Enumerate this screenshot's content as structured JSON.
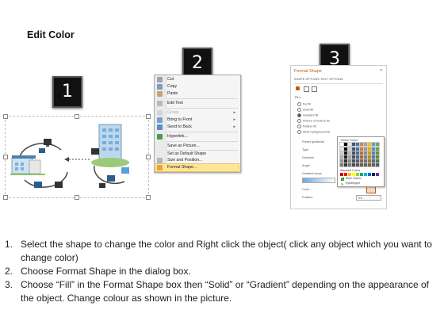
{
  "title": "Edit Color",
  "badges": [
    "1",
    "2",
    "3"
  ],
  "context_menu": {
    "items": [
      {
        "label": "Cut",
        "disabled": false,
        "submenu": false
      },
      {
        "label": "Copy",
        "disabled": false,
        "submenu": false
      },
      {
        "label": "Paste",
        "disabled": false,
        "submenu": false
      },
      {
        "label": "Edit Text",
        "disabled": false,
        "submenu": false
      },
      {
        "label": "Group",
        "disabled": true,
        "submenu": true
      },
      {
        "label": "Bring to Front",
        "disabled": false,
        "submenu": true
      },
      {
        "label": "Send to Back",
        "disabled": false,
        "submenu": true
      },
      {
        "label": "Hyperlink...",
        "disabled": false,
        "submenu": false
      },
      {
        "label": "Save as Picture...",
        "disabled": false,
        "submenu": false
      },
      {
        "label": "Set as Default Shape",
        "disabled": false,
        "submenu": false
      },
      {
        "label": "Size and Position...",
        "disabled": false,
        "submenu": false
      },
      {
        "label": "Format Shape...",
        "disabled": false,
        "submenu": false,
        "highlighted": true
      }
    ]
  },
  "format_pane": {
    "title": "Format Shape",
    "tabs": "SHAPE OPTIONS   TEXT OPTIONS",
    "fill_header": "FILL",
    "fill_options": [
      "No fill",
      "Solid fill",
      "Gradient fill",
      "Picture or texture fill",
      "Pattern fill",
      "Slide background fill"
    ],
    "fields": [
      "Preset gradients",
      "Type",
      "Direction",
      "Angle",
      "Gradient stops",
      "Color",
      "Position"
    ],
    "position_value": "0%",
    "color_popup": {
      "theme_label": "Theme Colors",
      "standard_label": "Standard Colors",
      "more_colors": "More Colors...",
      "eyedropper": "Eyedropper"
    }
  },
  "steps": [
    {
      "num": "1.",
      "text": "Select the shape to change the color and Right click the object( click any object which you want to change color)"
    },
    {
      "num": "2.",
      "text": "Choose Format Shape in the dialog box."
    },
    {
      "num": "3.",
      "text": "Choose “Fill” in the Format Shape box then “Solid” or “Gradient” depending on the appearance of the object. Change colour as shown in the picture."
    }
  ],
  "colors": {
    "accent_orange": "#c55a11",
    "highlight": "#ffe59a",
    "badge_bg": "#111111"
  }
}
